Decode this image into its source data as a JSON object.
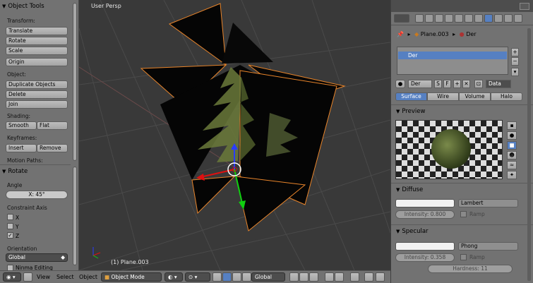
{
  "toolshelf": {
    "title": "Object Tools",
    "transform_label": "Transform:",
    "translate": "Translate",
    "rotate": "Rotate",
    "scale": "Scale",
    "origin": "Origin",
    "object_label": "Object:",
    "duplicate": "Duplicate Objects",
    "delete": "Delete",
    "join": "Join",
    "shading_label": "Shading:",
    "smooth": "Smooth",
    "flat": "Flat",
    "keyframes_label": "Keyframes:",
    "insert": "Insert",
    "remove": "Remove",
    "motion_paths_label": "Motion Paths:",
    "operator_title": "Rotate",
    "angle_label": "Angle",
    "angle_value": "X: 45°",
    "constraint_axis_label": "Constraint Axis",
    "axis_x": "X",
    "axis_y": "Y",
    "axis_z": "Z",
    "axis_z_checked": "✓",
    "orientation_label": "Orientation",
    "orientation_value": "Global",
    "cut_label": "Ninma Editing"
  },
  "viewport": {
    "view_name": "User Persp",
    "object_label": "(1) Plane.003"
  },
  "bottombar": {
    "view": "View",
    "select": "Select",
    "object": "Object",
    "mode": "Object Mode",
    "orientation": "Global"
  },
  "properties": {
    "breadcrumb_object": "Plane.003",
    "breadcrumb_material": "Der",
    "slot_name": "Der",
    "material_name": "Der",
    "users_f": "F",
    "users_s": "S",
    "link_value": "Data",
    "tabs": [
      "Surface",
      "Wire",
      "Volume",
      "Halo"
    ],
    "preview_title": "Preview",
    "diffuse_title": "Diffuse",
    "diffuse_shader": "Lambert",
    "diffuse_intensity": "Intensity: 0.800",
    "diffuse_ramp": "Ramp",
    "specular_title": "Specular",
    "specular_shader": "Phong",
    "specular_intensity": "Intensity: 0.358",
    "specular_ramp": "Ramp",
    "hardness": "Hardness: 11"
  },
  "colors": {
    "selected_outline": "#e8842a",
    "active_tab": "#5680c2",
    "viewport_bg": "#393939",
    "panel_bg": "#727272"
  }
}
